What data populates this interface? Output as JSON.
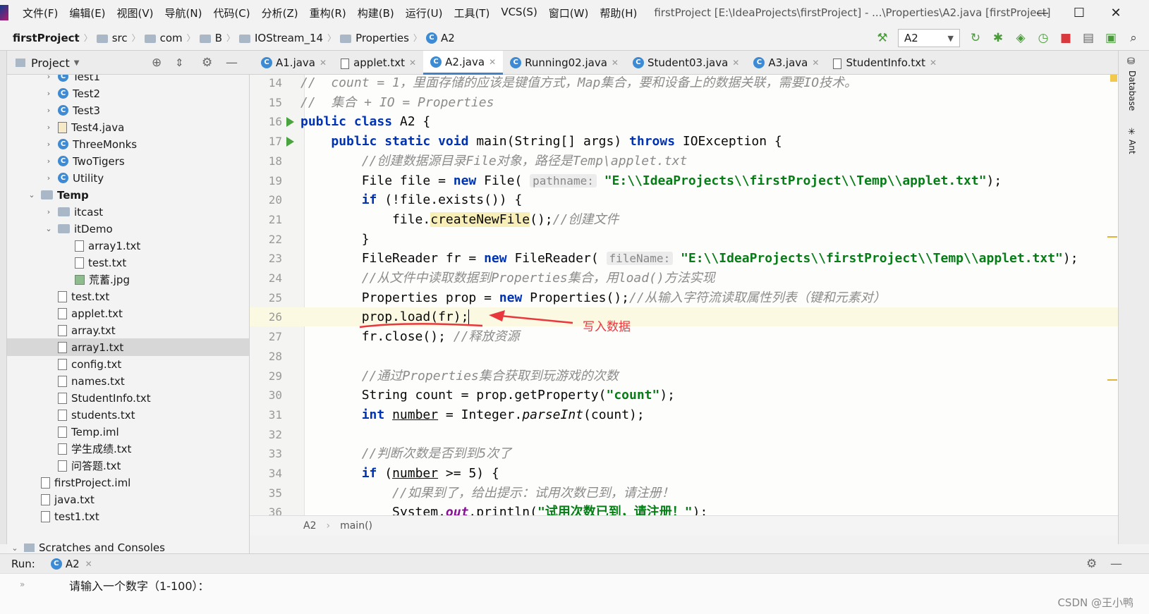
{
  "menu": {
    "items": [
      "文件(F)",
      "编辑(E)",
      "视图(V)",
      "导航(N)",
      "代码(C)",
      "分析(Z)",
      "重构(R)",
      "构建(B)",
      "运行(U)",
      "工具(T)",
      "VCS(S)",
      "窗口(W)",
      "帮助(H)"
    ],
    "window_title": "firstProject [E:\\IdeaProjects\\firstProject] - ...\\Properties\\A2.java [firstProject]"
  },
  "breadcrumb": [
    "firstProject",
    "src",
    "com",
    "B",
    "IOStream_14",
    "Properties",
    "A2"
  ],
  "run_config": "A2",
  "project_panel": {
    "title": "Project"
  },
  "editor_tabs": [
    "A1.java",
    "applet.txt",
    "A2.java",
    "Running02.java",
    "Student03.java",
    "A3.java",
    "StudentInfo.txt"
  ],
  "active_tab": "A2.java",
  "tree": [
    {
      "label": "Test1",
      "icon": "class-icon",
      "indent": 1,
      "chev": "›"
    },
    {
      "label": "Test2",
      "icon": "class-icon",
      "indent": 1,
      "chev": "›"
    },
    {
      "label": "Test3",
      "icon": "class-icon",
      "indent": 1,
      "chev": "›"
    },
    {
      "label": "Test4.java",
      "icon": "java-file-icon",
      "indent": 1,
      "chev": "›"
    },
    {
      "label": "ThreeMonks",
      "icon": "class-icon",
      "indent": 1,
      "chev": "›"
    },
    {
      "label": "TwoTigers",
      "icon": "class-icon",
      "indent": 1,
      "chev": "›"
    },
    {
      "label": "Utility",
      "icon": "class-icon",
      "indent": 1,
      "chev": "›"
    },
    {
      "label": "Temp",
      "icon": "folder-icon",
      "indent": 0,
      "chev": "⌄",
      "bold": true
    },
    {
      "label": "itcast",
      "icon": "folder-icon",
      "indent": 1,
      "chev": "›"
    },
    {
      "label": "itDemo",
      "icon": "folder-icon",
      "indent": 1,
      "chev": "⌄"
    },
    {
      "label": "array1.txt",
      "icon": "text-file-icon",
      "indent": 2,
      "chev": ""
    },
    {
      "label": "test.txt",
      "icon": "text-file-icon",
      "indent": 2,
      "chev": ""
    },
    {
      "label": "荒蓄.jpg",
      "icon": "image-file-icon",
      "indent": 2,
      "chev": ""
    },
    {
      "label": "test.txt",
      "icon": "text-file-icon",
      "indent": 1,
      "chev": ""
    },
    {
      "label": "applet.txt",
      "icon": "text-file-icon",
      "indent": 1,
      "chev": ""
    },
    {
      "label": "array.txt",
      "icon": "text-file-icon",
      "indent": 1,
      "chev": ""
    },
    {
      "label": "array1.txt",
      "icon": "text-file-icon",
      "indent": 1,
      "chev": "",
      "selected": true
    },
    {
      "label": "config.txt",
      "icon": "text-file-icon",
      "indent": 1,
      "chev": ""
    },
    {
      "label": "names.txt",
      "icon": "text-file-icon",
      "indent": 1,
      "chev": ""
    },
    {
      "label": "StudentInfo.txt",
      "icon": "text-file-icon",
      "indent": 1,
      "chev": ""
    },
    {
      "label": "students.txt",
      "icon": "text-file-icon",
      "indent": 1,
      "chev": ""
    },
    {
      "label": "Temp.iml",
      "icon": "text-file-icon",
      "indent": 1,
      "chev": ""
    },
    {
      "label": "学生成绩.txt",
      "icon": "text-file-icon",
      "indent": 1,
      "chev": ""
    },
    {
      "label": "问答题.txt",
      "icon": "text-file-icon",
      "indent": 1,
      "chev": ""
    },
    {
      "label": "firstProject.iml",
      "icon": "text-file-icon",
      "indent": 0,
      "chev": ""
    },
    {
      "label": "java.txt",
      "icon": "text-file-icon",
      "indent": 0,
      "chev": ""
    },
    {
      "label": "test1.txt",
      "icon": "text-file-icon",
      "indent": 0,
      "chev": ""
    }
  ],
  "scratches_label": "Scratches and Consoles",
  "code": [
    {
      "n": "14",
      "tokens": [
        [
          "cmt",
          "//  count = 1，里面存储的应该是键值方式，Map集合，要和设备上的数据关联，需要IO技术。"
        ]
      ]
    },
    {
      "n": "15",
      "tokens": [
        [
          "cmt",
          "//  集合 + IO = Properties"
        ]
      ]
    },
    {
      "n": "16",
      "run": true,
      "tokens": [
        [
          "kw",
          "public class "
        ],
        [
          "",
          "A2 {"
        ]
      ]
    },
    {
      "n": "17",
      "run": true,
      "tokens": [
        [
          "",
          "    "
        ],
        [
          "kw",
          "public static void "
        ],
        [
          "",
          "main(String[] args) "
        ],
        [
          "kw",
          "throws "
        ],
        [
          "",
          "IOException {"
        ]
      ]
    },
    {
      "n": "18",
      "tokens": [
        [
          "",
          "        "
        ],
        [
          "cmt",
          "//创建数据源目录File对象，路径是Temp\\applet.txt"
        ]
      ]
    },
    {
      "n": "19",
      "tokens": [
        [
          "",
          "        File file = "
        ],
        [
          "kw",
          "new "
        ],
        [
          "",
          "File( "
        ],
        [
          "hint",
          "pathname:"
        ],
        [
          "",
          " "
        ],
        [
          "str",
          "\"E:\\\\IdeaProjects\\\\firstProject\\\\Temp\\\\applet.txt\""
        ],
        [
          "",
          ");"
        ]
      ]
    },
    {
      "n": "20",
      "tokens": [
        [
          "",
          "        "
        ],
        [
          "kw",
          "if "
        ],
        [
          "",
          "(!file.exists()) {"
        ]
      ]
    },
    {
      "n": "21",
      "tokens": [
        [
          "",
          "            file."
        ],
        [
          "hl",
          "createNewFile"
        ],
        [
          "",
          "();"
        ],
        [
          "cmt",
          "//创建文件"
        ]
      ]
    },
    {
      "n": "22",
      "tokens": [
        [
          "",
          "        }"
        ]
      ]
    },
    {
      "n": "23",
      "tokens": [
        [
          "",
          "        FileReader fr = "
        ],
        [
          "kw",
          "new "
        ],
        [
          "",
          "FileReader( "
        ],
        [
          "hint",
          "fileName:"
        ],
        [
          "",
          " "
        ],
        [
          "str",
          "\"E:\\\\IdeaProjects\\\\firstProject\\\\Temp\\\\applet.txt\""
        ],
        [
          "",
          ");"
        ]
      ]
    },
    {
      "n": "24",
      "tokens": [
        [
          "",
          "        "
        ],
        [
          "cmt",
          "//从文件中读取数据到Properties集合，用load()方法实现"
        ]
      ]
    },
    {
      "n": "25",
      "tokens": [
        [
          "",
          "        Properties prop = "
        ],
        [
          "kw",
          "new "
        ],
        [
          "",
          "Properties();"
        ],
        [
          "cmt",
          "//从输入字符流读取属性列表（键和元素对）"
        ]
      ]
    },
    {
      "n": "26",
      "current": true,
      "tokens": [
        [
          "",
          "        prop.load(fr);"
        ]
      ]
    },
    {
      "n": "27",
      "tokens": [
        [
          "",
          "        fr.close(); "
        ],
        [
          "cmt",
          "//释放资源"
        ]
      ]
    },
    {
      "n": "28",
      "tokens": []
    },
    {
      "n": "29",
      "tokens": [
        [
          "",
          "        "
        ],
        [
          "cmt",
          "//通过Properties集合获取到玩游戏的次数"
        ]
      ]
    },
    {
      "n": "30",
      "tokens": [
        [
          "",
          "        String count = prop.getProperty("
        ],
        [
          "str",
          "\"count\""
        ],
        [
          "",
          ");"
        ]
      ]
    },
    {
      "n": "31",
      "tokens": [
        [
          "",
          "        "
        ],
        [
          "kw",
          "int "
        ],
        [
          "ul",
          "number"
        ],
        [
          "",
          " = Integer."
        ],
        [
          "it",
          "parseInt"
        ],
        [
          "",
          "(count);"
        ]
      ]
    },
    {
      "n": "32",
      "tokens": []
    },
    {
      "n": "33",
      "tokens": [
        [
          "",
          "        "
        ],
        [
          "cmt",
          "//判断次数是否到到5次了"
        ]
      ]
    },
    {
      "n": "34",
      "tokens": [
        [
          "",
          "        "
        ],
        [
          "kw",
          "if "
        ],
        [
          "",
          "("
        ],
        [
          "ul",
          "number"
        ],
        [
          "",
          " >= 5) {"
        ]
      ]
    },
    {
      "n": "35",
      "tokens": [
        [
          "",
          "            "
        ],
        [
          "cmt",
          "//如果到了，给出提示：试用次数已到，请注册！"
        ]
      ]
    },
    {
      "n": "36",
      "tokens": [
        [
          "",
          "            System."
        ],
        [
          "fld",
          "out"
        ],
        [
          "",
          ".println("
        ],
        [
          "str",
          "\"试用次数已到，请注册！\""
        ],
        [
          "",
          ");"
        ]
      ]
    }
  ],
  "annotation": "写入数据",
  "editor_breadcrumb": [
    "A2",
    "main()"
  ],
  "right_tools": [
    "Database",
    "Ant"
  ],
  "run_panel": {
    "label": "Run:",
    "tab": "A2"
  },
  "console_text": "请输入一个数字（1-100）：",
  "watermark": "CSDN @王小鸭",
  "colors": {
    "keyword": "#0033b3",
    "string": "#067d17",
    "comment": "#8c8c8c",
    "accent": "#4083c9",
    "annotation": "#e8383d"
  }
}
